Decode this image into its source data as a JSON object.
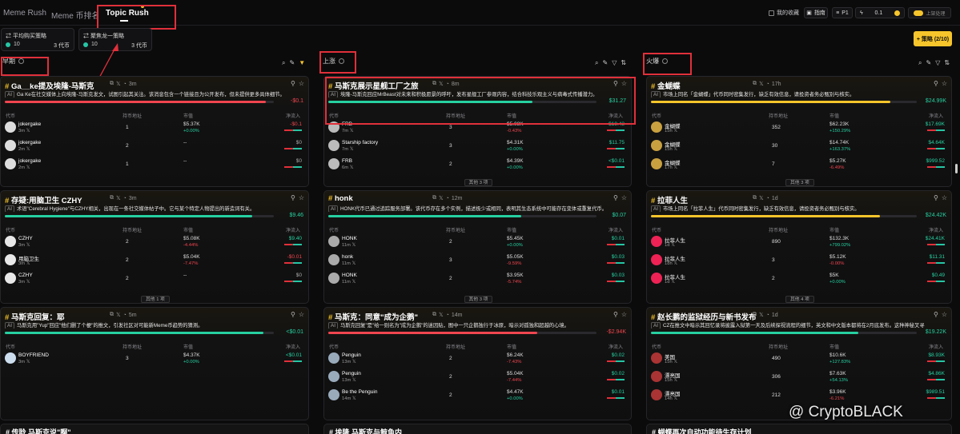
{
  "nav": {
    "meme_rush": "Meme Rush",
    "meme_rank": "Meme 币排名",
    "topic_rush": "Topic Rush"
  },
  "topright": {
    "favorites": "我的收藏",
    "guide": "指南",
    "p1": "P1",
    "amount": "0.1",
    "toggle_label": "上架处理"
  },
  "strategies": [
    {
      "title": "平均购买策略",
      "num": "10",
      "count": "3 代币"
    },
    {
      "title": "聚焦龙一策略",
      "num": "10",
      "count": "3 代币"
    }
  ],
  "strategy_button": "+ 策略 (2/10)",
  "columns": {
    "col1": "早期",
    "col2": "上涨",
    "col3": "火爆"
  },
  "labels": {
    "ai": "AI",
    "holders": "持币地址",
    "mcap": "市值",
    "netflow": "净流入",
    "token": "代币"
  },
  "cards": {
    "c1": {
      "title": "Ga__ke提及埃隆-马斯克",
      "age": "3m",
      "desc": "Ga Ke在社交媒体上向埃隆-马斯克发文，试图引起其关注。该消息包含一个链接且为公开发布，但未提供更多具体细节。",
      "cap": "-$0.1",
      "more": "",
      "rows": [
        {
          "name": "jokergake",
          "sub": "3m",
          "holders": "1",
          "mc": "$5.37K",
          "pct": "+0.00%",
          "net": "-$0.1"
        },
        {
          "name": "jokergake",
          "sub": "2m",
          "holders": "2",
          "mc": "--",
          "pct": "",
          "net": "$0"
        },
        {
          "name": "jokergake",
          "sub": "2m",
          "holders": "1",
          "mc": "--",
          "pct": "",
          "net": "$0"
        }
      ]
    },
    "c2": {
      "title": "存疑:用脑卫生 CZHY",
      "age": "3m",
      "desc": "术语\"Cerebral Hygiene\"与CZHY相关，出现在一条社交媒体帖子中。它与某个特定人物提出的新造词有关。",
      "cap": "$9.46",
      "more": "其他 1 项",
      "rows": [
        {
          "name": "CZHY",
          "sub": "3m",
          "holders": "2",
          "mc": "$5.08K",
          "pct": "-4.44%",
          "net": "$9.40"
        },
        {
          "name": "用脑卫生",
          "sub": "3m",
          "holders": "2",
          "mc": "$5.04K",
          "pct": "-7.47%",
          "net": "-$0.01"
        },
        {
          "name": "CZHY",
          "sub": "3m",
          "holders": "2",
          "mc": "--",
          "pct": "",
          "net": "$0"
        }
      ]
    },
    "c3": {
      "title": "马斯克回复：耶",
      "age": "5m",
      "desc": "马斯克用\"Yup\"回应\"他们删了个梗\"的推文，引发社区对可能新Meme币趋势的猜测。",
      "cap": "<$0.01",
      "more": "",
      "rows": [
        {
          "name": "BOYFRIEND",
          "sub": "3m",
          "holders": "3",
          "mc": "$4.37K",
          "pct": "+0.00%",
          "net": "<$0.01"
        }
      ]
    },
    "c4": {
      "title": "马斯克展示星舰工厂之旅",
      "age": "8m",
      "desc": "埃隆-马斯克回应MrBeast对未来和积极愿景的呼吁，发布星舰工厂参观内容，结合科技乐观主义与病毒式传播潜力。",
      "cap": "$31.27",
      "more": "其他 3 项",
      "rows": [
        {
          "name": "FRB",
          "sub": "7m",
          "holders": "3",
          "mc": "$5.08K",
          "pct": "-0.43%",
          "net": "$19.43"
        },
        {
          "name": "Starship factory",
          "sub": "7m",
          "holders": "3",
          "mc": "$4.31K",
          "pct": "+0.00%",
          "net": "$11.75"
        },
        {
          "name": "FRB",
          "sub": "6m",
          "holders": "2",
          "mc": "$4.39K",
          "pct": "+0.00%",
          "net": "<$0.01"
        }
      ]
    },
    "c5": {
      "title": "honk",
      "age": "12m",
      "desc": "HONK代币已通过追踪服务部署。该代币存在多个实例，描述极少或相同，表明其生态系统中可能存在变体或重复代币。",
      "cap": "$0.07",
      "more": "其他 3 项",
      "rows": [
        {
          "name": "HONK",
          "sub": "11m",
          "holders": "2",
          "mc": "$5.45K",
          "pct": "+0.00%",
          "net": "$0.01"
        },
        {
          "name": "honk",
          "sub": "11m",
          "holders": "3",
          "mc": "$5.05K",
          "pct": "-9.59%",
          "net": "$0.03"
        },
        {
          "name": "HONK",
          "sub": "11m",
          "holders": "2",
          "mc": "$3.95K",
          "pct": "-5.74%",
          "net": "$0.03"
        }
      ]
    },
    "c6": {
      "title": "马斯克：同意\"成为企鹅\"",
      "age": "14m",
      "desc": "马斯克回复\"是\"给一则名为\"成为企鹅\"的迷因贴，图中一只企鹅独行于冰原，暗示对孤独和超越的心境。",
      "cap": "-$2.94K",
      "more": "",
      "rows": [
        {
          "name": "Penguin",
          "sub": "13m",
          "holders": "2",
          "mc": "$6.24K",
          "pct": "-7.43%",
          "net": "$0.02"
        },
        {
          "name": "Penguin",
          "sub": "13m",
          "holders": "2",
          "mc": "$5.04K",
          "pct": "-7.44%",
          "net": "$0.02"
        },
        {
          "name": "Be the Penguin",
          "sub": "14m",
          "holders": "2",
          "mc": "$4.47K",
          "pct": "+0.00%",
          "net": "$0.01"
        }
      ]
    },
    "c7": {
      "title": "金蝴蝶",
      "age": "17h",
      "desc": "市场上同名「金蝴蝶」代币同时密集发行，缺乏有效信息，请投资者务必甄别与核实。",
      "cap": "$24.99K",
      "more": "其他 3 项",
      "rows": [
        {
          "name": "金蝴蝶",
          "sub": "15h",
          "holders": "352",
          "mc": "$62.23K",
          "pct": "+150.29%",
          "net": "$17.69K"
        },
        {
          "name": "金蝴蝶",
          "sub": "15h",
          "holders": "30",
          "mc": "$14.74K",
          "pct": "+163.37%",
          "net": "$4.64K"
        },
        {
          "name": "金蝴蝶",
          "sub": "17h",
          "holders": "7",
          "mc": "$5.27K",
          "pct": "-6.49%",
          "net": "$999.52"
        }
      ]
    },
    "c8": {
      "title": "拉菲人生",
      "age": "1d",
      "desc": "市场上同名「拉菲人生」代币同时密集发行，缺乏有效信息，请投资者务必甄别与核实。",
      "cap": "$24.42K",
      "more": "其他 4 项",
      "rows": [
        {
          "name": "拉菲人生",
          "sub": "1d",
          "holders": "890",
          "mc": "$132.3K",
          "pct": "+799.02%",
          "net": "$24.41K"
        },
        {
          "name": "拉菲人生",
          "sub": "18h",
          "holders": "3",
          "mc": "$5.12K",
          "pct": "-0.00%",
          "net": "$11.31"
        },
        {
          "name": "拉菲人生",
          "sub": "1d",
          "holders": "2",
          "mc": "$5K",
          "pct": "+0.00%",
          "net": "$0.49"
        }
      ]
    },
    "c9": {
      "title": "赵长鹏的监狱经历与新书发布",
      "age": "1d",
      "desc": "CZ在推文中暗示其回忆录将披露入狱第一天及后续探视流程的细节，英文和中文版本都将在2月底发布。这种神秘叉寻",
      "cap": "$19.22K",
      "more": "",
      "rows": [
        {
          "name": "美国",
          "sub": "15h",
          "holders": "490",
          "mc": "$10.6K",
          "pct": "+127.83%",
          "net": "$8.93K"
        },
        {
          "name": "漂亮国",
          "sub": "15h",
          "holders": "306",
          "mc": "$7.63K",
          "pct": "+54.13%",
          "net": "$4.86K"
        },
        {
          "name": "漂亮国",
          "sub": "14h",
          "holders": "212",
          "mc": "$3.96K",
          "pct": "-6.21%",
          "net": "$989.51"
        }
      ]
    }
  },
  "partials": {
    "p1": "# 传聆 马斯克说\"啊\"",
    "p2": "# 埃隆 马斯克与鲸鱼内",
    "p3": "# 蝴蝶再次自动功能待生存计划"
  },
  "watermark": "@ CryptoBLACK",
  "colors": {
    "accent": "#f6c52b",
    "green": "#26d0a0",
    "red": "#f0454f",
    "highlight": "#e0303a"
  }
}
